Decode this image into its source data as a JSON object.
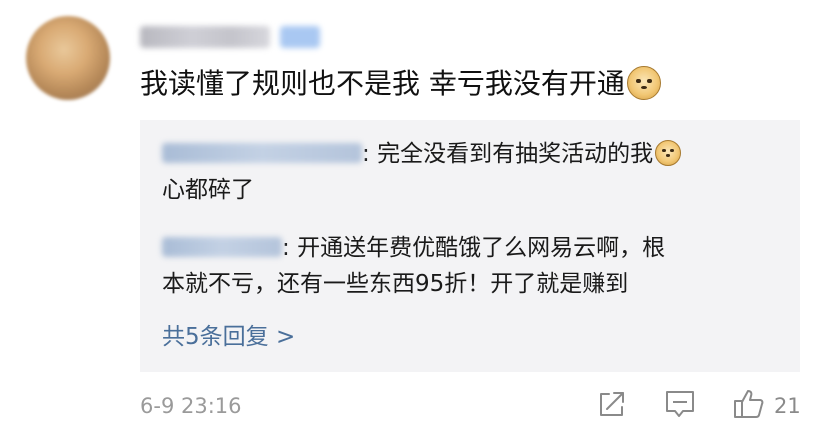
{
  "comment": {
    "username": "",
    "vip_badge": "",
    "text": "我读懂了规则也不是我  幸亏我没有开通",
    "timestamp": "6-9 23:16",
    "like_count": "21"
  },
  "replies": [
    {
      "username": "",
      "separator": ": ",
      "line1": "完全没看到有抽奖活动的我",
      "line2": "心都碎了"
    },
    {
      "username": "",
      "separator": ": ",
      "line1": "开通送年费优酷饿了么网易云啊，根",
      "line2": "本就不亏，还有一些东西95折！开了就是赚到"
    }
  ],
  "more_replies_label": "共5条回复 >",
  "icons": {
    "emoji": "doge-emoji-icon",
    "share": "share-icon",
    "comment": "comment-icon",
    "like": "thumbs-up-icon"
  },
  "colors": {
    "link": "#4a6f9a",
    "reply_bg": "#f3f3f5",
    "muted": "#9a9a9a"
  }
}
